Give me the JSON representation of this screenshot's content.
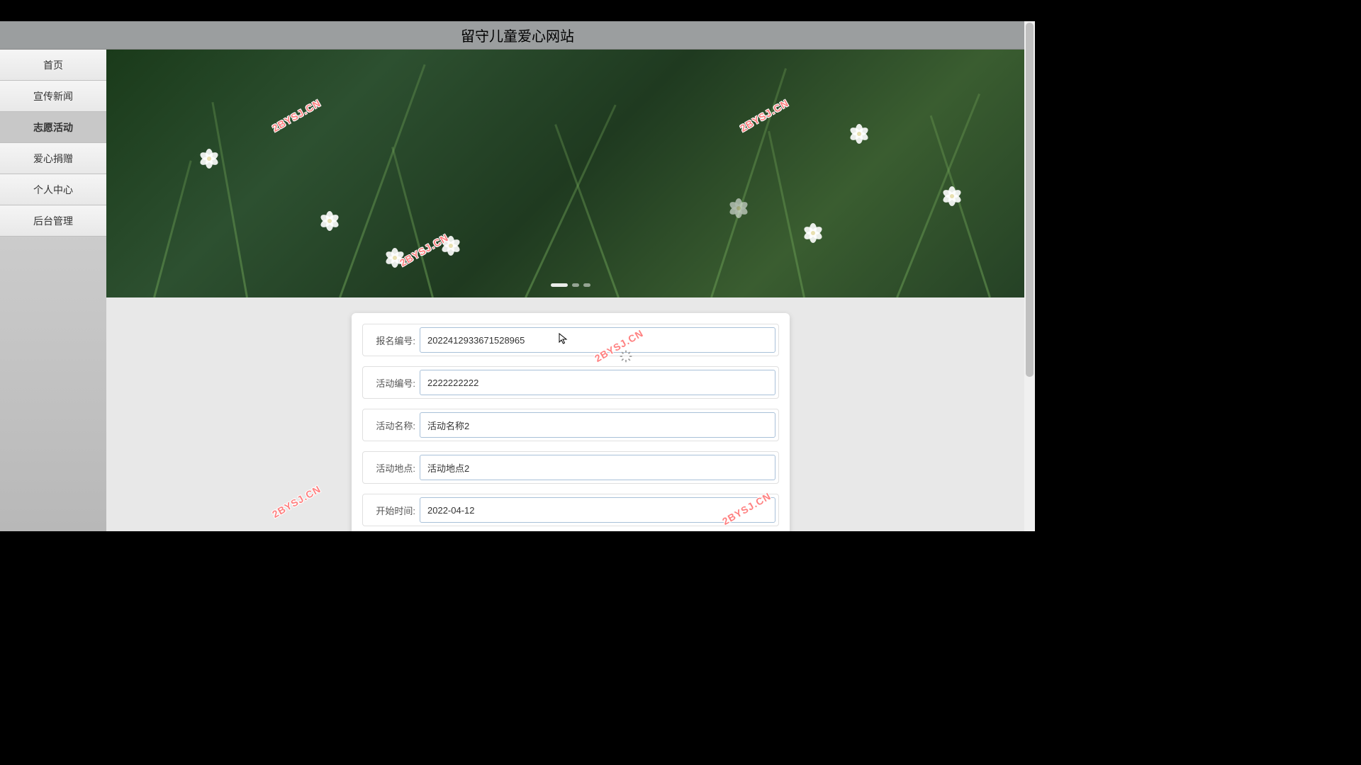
{
  "header": {
    "title": "留守儿童爱心网站"
  },
  "sidebar": {
    "items": [
      {
        "label": "首页",
        "active": false
      },
      {
        "label": "宣传新闻",
        "active": false
      },
      {
        "label": "志愿活动",
        "active": true
      },
      {
        "label": "爱心捐赠",
        "active": false
      },
      {
        "label": "个人中心",
        "active": false
      },
      {
        "label": "后台管理",
        "active": false
      }
    ]
  },
  "watermark_text": "2BYSJ.CN",
  "carousel": {
    "count": 3,
    "active_index": 0
  },
  "form": {
    "fields": [
      {
        "label": "报名编号:",
        "value": "2022412933671528965",
        "name": "registration-id"
      },
      {
        "label": "活动编号:",
        "value": "2222222222",
        "name": "activity-id"
      },
      {
        "label": "活动名称:",
        "value": "活动名称2",
        "name": "activity-name"
      },
      {
        "label": "活动地点:",
        "value": "活动地点2",
        "name": "activity-location"
      },
      {
        "label": "开始时间:",
        "value": "2022-04-12",
        "name": "start-time"
      }
    ]
  }
}
